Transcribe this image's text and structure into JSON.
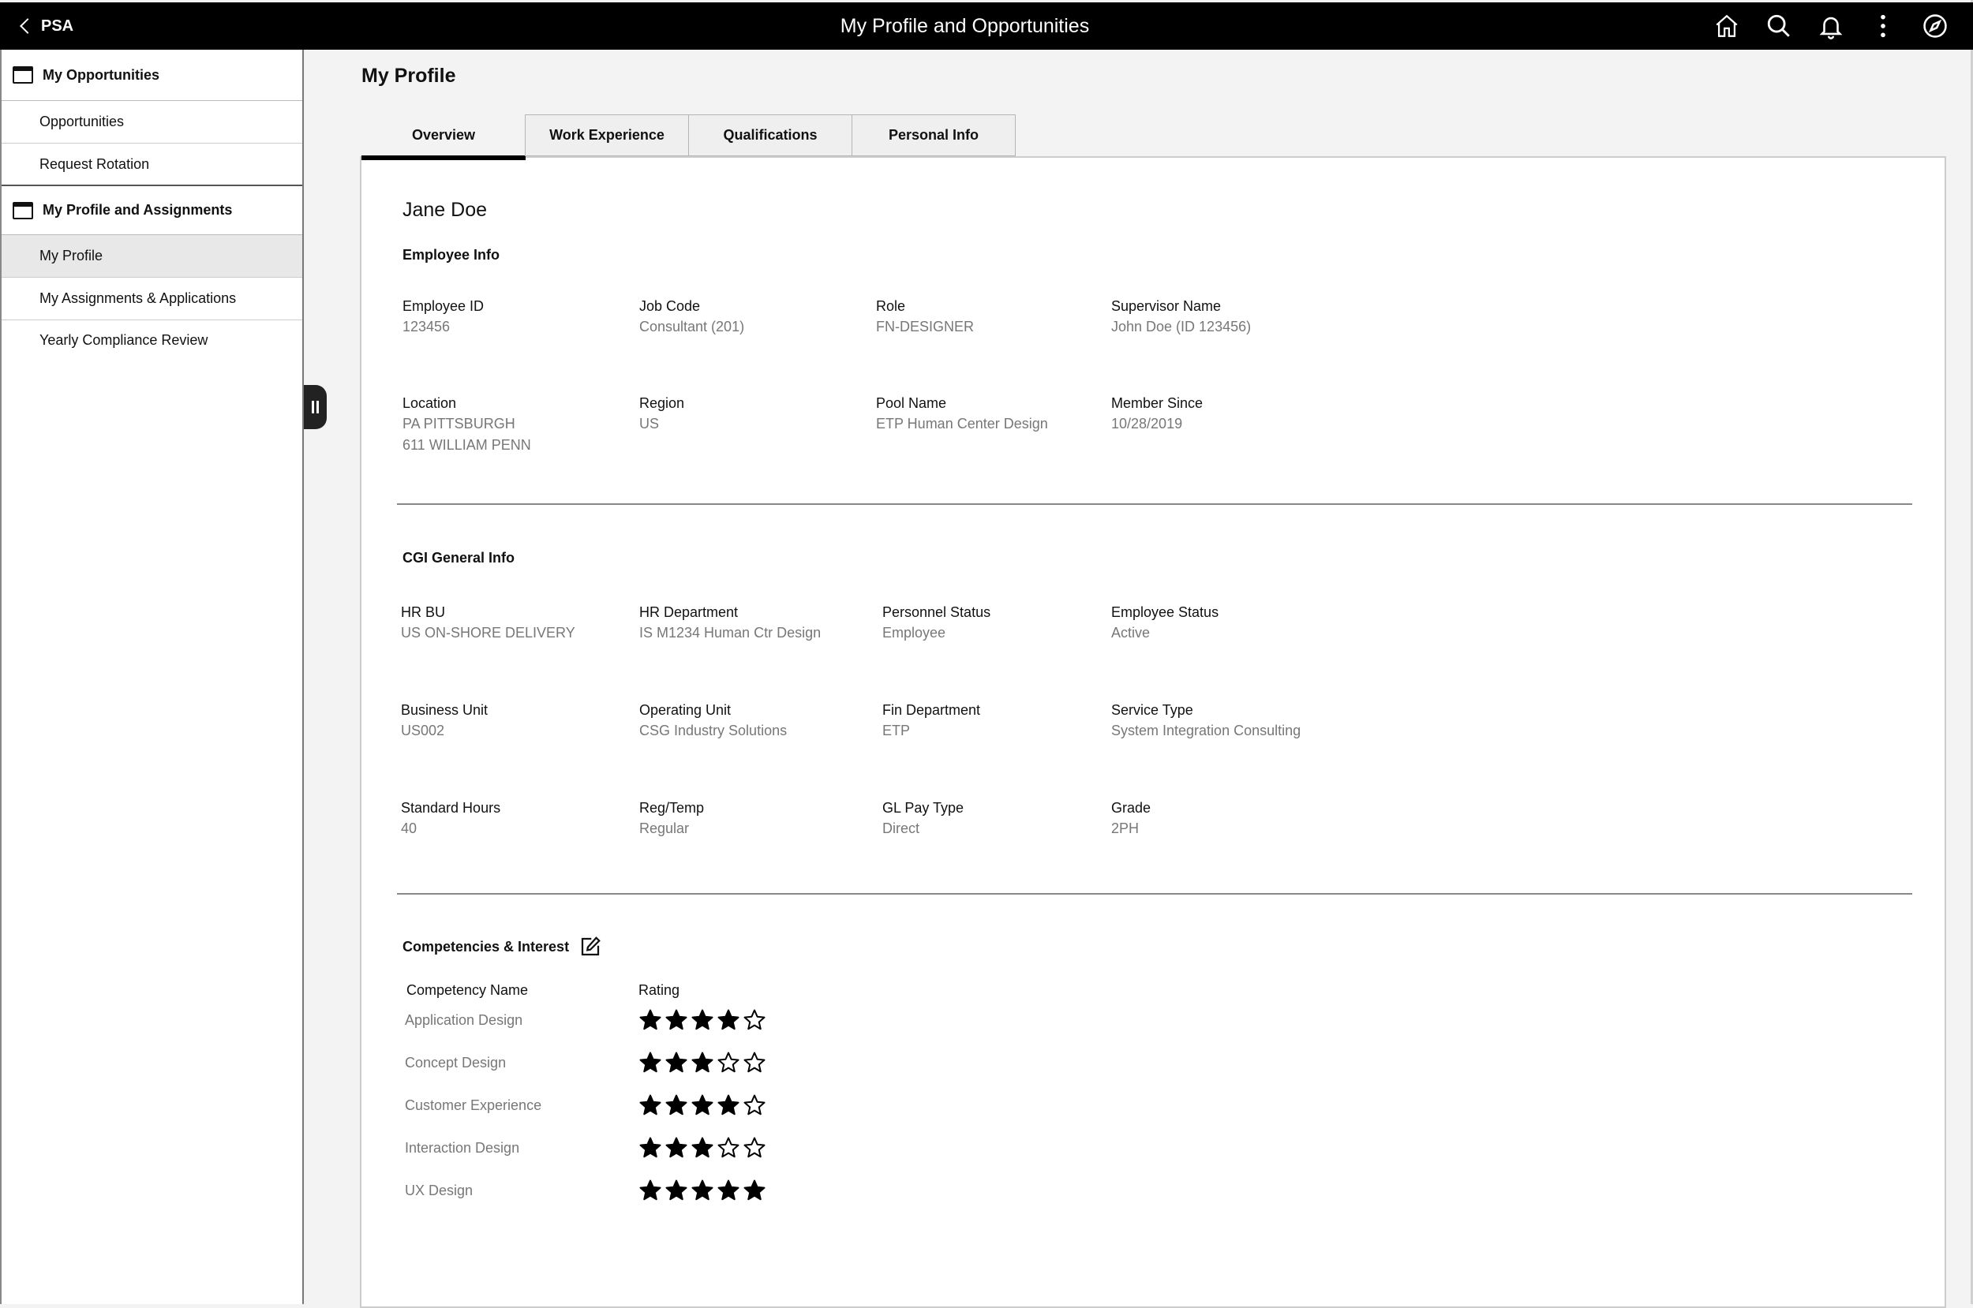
{
  "topbar": {
    "back_label": "PSA",
    "title": "My Profile and Opportunities",
    "icons": [
      "home-icon",
      "search-icon",
      "bell-icon",
      "more-vertical-icon",
      "compass-icon"
    ]
  },
  "sidebar": {
    "groups": [
      {
        "label": "My Opportunities",
        "items": [
          "Opportunities",
          "Request Rotation"
        ]
      },
      {
        "label": "My Profile and Assignments",
        "items": [
          "My Profile",
          "My Assignments & Applications",
          "Yearly Compliance Review"
        ]
      }
    ],
    "active_item": "My Profile"
  },
  "page": {
    "title": "My Profile",
    "tabs": [
      "Overview",
      "Work Experience",
      "Qualifications",
      "Personal Info"
    ],
    "active_tab": "Overview"
  },
  "profile": {
    "name": "Jane Doe",
    "employee_info": {
      "title": "Employee Info",
      "fields": [
        {
          "label": "Employee ID",
          "value": "123456"
        },
        {
          "label": "Job Code",
          "value": "Consultant (201)"
        },
        {
          "label": "Role",
          "value": "FN-DESIGNER"
        },
        {
          "label": "Supervisor Name",
          "value": "John Doe (ID 123456)"
        },
        {
          "label": "Location",
          "value": "PA PITTSBURGH",
          "value2": "611 WILLIAM PENN"
        },
        {
          "label": "Region",
          "value": "US"
        },
        {
          "label": "Pool Name",
          "value": "ETP Human Center Design"
        },
        {
          "label": "Member Since",
          "value": "10/28/2019"
        }
      ]
    },
    "general_info": {
      "title": "CGI General Info",
      "fields": [
        {
          "label": "HR BU",
          "value": "US ON-SHORE DELIVERY"
        },
        {
          "label": "HR Department",
          "value": "IS M1234 Human Ctr Design"
        },
        {
          "label": "Personnel Status",
          "value": "Employee"
        },
        {
          "label": "Employee Status",
          "value": "Active"
        },
        {
          "label": "Business Unit",
          "value": "US002"
        },
        {
          "label": "Operating Unit",
          "value": "CSG Industry Solutions"
        },
        {
          "label": "Fin Department",
          "value": "ETP"
        },
        {
          "label": "Service Type",
          "value": "System Integration Consulting"
        },
        {
          "label": "Standard Hours",
          "value": "40"
        },
        {
          "label": "Reg/Temp",
          "value": "Regular"
        },
        {
          "label": "GL Pay Type",
          "value": "Direct"
        },
        {
          "label": "Grade",
          "value": "2PH"
        }
      ]
    },
    "competencies": {
      "title": "Competencies & Interest",
      "col_name": "Competency Name",
      "col_rating": "Rating",
      "max_rating": 5,
      "rows": [
        {
          "name": "Application Design",
          "rating": 4
        },
        {
          "name": "Concept Design",
          "rating": 3
        },
        {
          "name": "Customer Experience",
          "rating": 4
        },
        {
          "name": "Interaction Design",
          "rating": 3
        },
        {
          "name": "UX Design",
          "rating": 5
        }
      ]
    }
  }
}
